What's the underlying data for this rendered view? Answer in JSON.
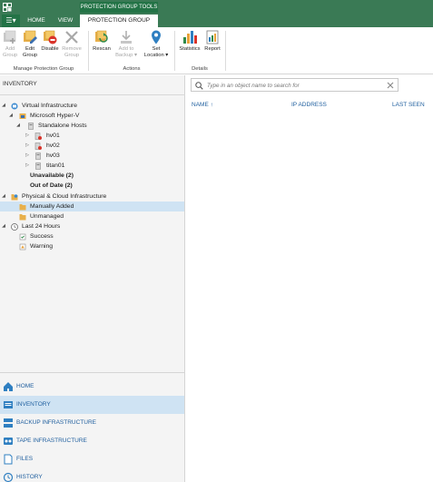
{
  "titlebar": {
    "tools_label": "PROTECTION GROUP TOOLS",
    "menu_icon": "hamburger-icon",
    "tabs": [
      {
        "label": "HOME"
      },
      {
        "label": "VIEW"
      },
      {
        "label": "PROTECTION GROUP"
      }
    ]
  },
  "ribbon": {
    "groups": [
      {
        "label": "Manage Protection Group"
      },
      {
        "label": "Actions"
      },
      {
        "label": "Details"
      }
    ],
    "buttons": {
      "add_group": {
        "line1": "Add",
        "line2": "Group",
        "icon": "add-group-icon",
        "enabled": false
      },
      "edit_group": {
        "line1": "Edit",
        "line2": "Group",
        "icon": "edit-group-icon",
        "enabled": true
      },
      "disable": {
        "line1": "Disable",
        "line2": "",
        "icon": "disable-icon",
        "enabled": true
      },
      "remove_group": {
        "line1": "Remove",
        "line2": "Group",
        "icon": "remove-icon",
        "enabled": false
      },
      "rescan": {
        "line1": "Rescan",
        "line2": "",
        "icon": "rescan-icon",
        "enabled": true
      },
      "add_to_backup": {
        "line1": "Add to",
        "line2": "Backup ▾",
        "icon": "add-to-backup-icon",
        "enabled": false
      },
      "set_location": {
        "line1": "Set",
        "line2": "Location ▾",
        "icon": "location-pin-icon",
        "enabled": true
      },
      "statistics": {
        "line1": "Statistics",
        "line2": "",
        "icon": "statistics-icon",
        "enabled": true
      },
      "report": {
        "line1": "Report",
        "line2": "",
        "icon": "report-icon",
        "enabled": true
      }
    }
  },
  "left_pane": {
    "header": "INVENTORY",
    "tree": [
      {
        "label": "Virtual Infrastructure",
        "icon": "virtual-infrastructure-icon",
        "bold": false
      },
      {
        "label": "Microsoft Hyper-V",
        "icon": "hyper-v-icon",
        "bold": false
      },
      {
        "label": "Standalone Hosts",
        "icon": "hosts-icon",
        "bold": false
      },
      {
        "label": "hv01",
        "icon": "server-error-icon",
        "bold": false
      },
      {
        "label": "hv02",
        "icon": "server-error-icon",
        "bold": false
      },
      {
        "label": "hv03",
        "icon": "server-icon",
        "bold": false
      },
      {
        "label": "titan01",
        "icon": "server-icon",
        "bold": false
      },
      {
        "label": "Unavailable (2)",
        "icon": "",
        "bold": true
      },
      {
        "label": "Out of Date (2)",
        "icon": "",
        "bold": true
      },
      {
        "label": "Physical & Cloud Infrastructure",
        "icon": "physical-cloud-icon",
        "bold": false
      },
      {
        "label": "Manually Added",
        "icon": "folder-icon",
        "bold": false,
        "selected": true
      },
      {
        "label": "Unmanaged",
        "icon": "folder-icon",
        "bold": false
      },
      {
        "label": "Last 24 Hours",
        "icon": "clock-icon",
        "bold": false
      },
      {
        "label": "Success",
        "icon": "success-icon",
        "bold": false
      },
      {
        "label": "Warning",
        "icon": "warning-icon",
        "bold": false
      }
    ],
    "nav": [
      {
        "label": "HOME",
        "icon": "home-icon"
      },
      {
        "label": "INVENTORY",
        "icon": "inventory-icon",
        "active": true
      },
      {
        "label": "BACKUP INFRASTRUCTURE",
        "icon": "backup-infrastructure-icon"
      },
      {
        "label": "TAPE INFRASTRUCTURE",
        "icon": "tape-icon"
      },
      {
        "label": "FILES",
        "icon": "files-icon"
      },
      {
        "label": "HISTORY",
        "icon": "history-icon"
      }
    ]
  },
  "right_pane": {
    "search": {
      "placeholder": "Type in an object name to search for",
      "value": ""
    },
    "columns": [
      {
        "label": "NAME",
        "sort": "ascending"
      },
      {
        "label": "IP ADDRESS"
      },
      {
        "label": "LAST SEEN"
      }
    ]
  },
  "colors": {
    "brand_green": "#237346",
    "titlebar_green": "#3a7a55",
    "selection": "#cfe3f3",
    "link_blue": "#1e5e9e"
  }
}
